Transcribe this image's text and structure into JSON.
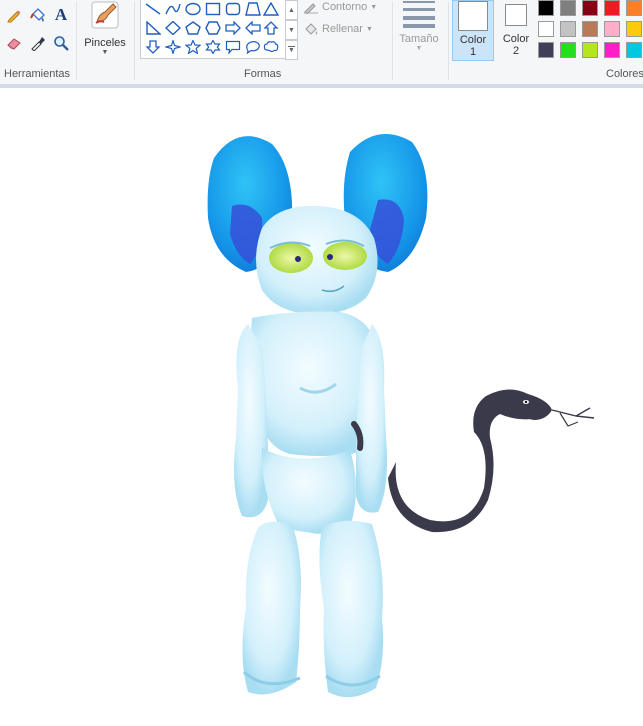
{
  "ribbon": {
    "groups": {
      "tools": "Herramientas",
      "shapes": "Formas",
      "colors": "Colores"
    },
    "tools": [
      {
        "icon": "pencil-icon"
      },
      {
        "icon": "fill-bucket-icon"
      },
      {
        "icon": "text-icon",
        "label": "A"
      },
      {
        "icon": "eraser-icon"
      },
      {
        "icon": "color-picker-icon"
      },
      {
        "icon": "magnifier-icon"
      }
    ],
    "brushes_label": "Pinceles",
    "outline_label": "Contorno",
    "fill_label": "Rellenar",
    "size_label": "Tamaño",
    "color1": {
      "line1": "Color",
      "line2": "1",
      "value": "#ffffff"
    },
    "color2": {
      "line1": "Color",
      "line2": "2",
      "value": "#ffffff"
    },
    "palette": [
      [
        "#000000",
        "#7f7f7f",
        "#880015",
        "#ed1c24",
        "#ff7f27"
      ],
      [
        "#ffffff",
        "#c3c3c3",
        "#b97a57",
        "#ffaec9",
        "#ffc90e"
      ],
      [
        "#3f3f5a",
        "#22e01a",
        "#b5e61d",
        "#ff1ec8",
        "#00c8e0"
      ]
    ]
  },
  "canvas": {
    "background": "#ffffff",
    "subject": "blue creature with snake tail",
    "colors": {
      "body": "#cfeefb",
      "ears": "#1aa6ee",
      "ear_inner": "#3550d8",
      "eyes": "#c6ea4a",
      "snake": "#3b3a4a"
    }
  }
}
